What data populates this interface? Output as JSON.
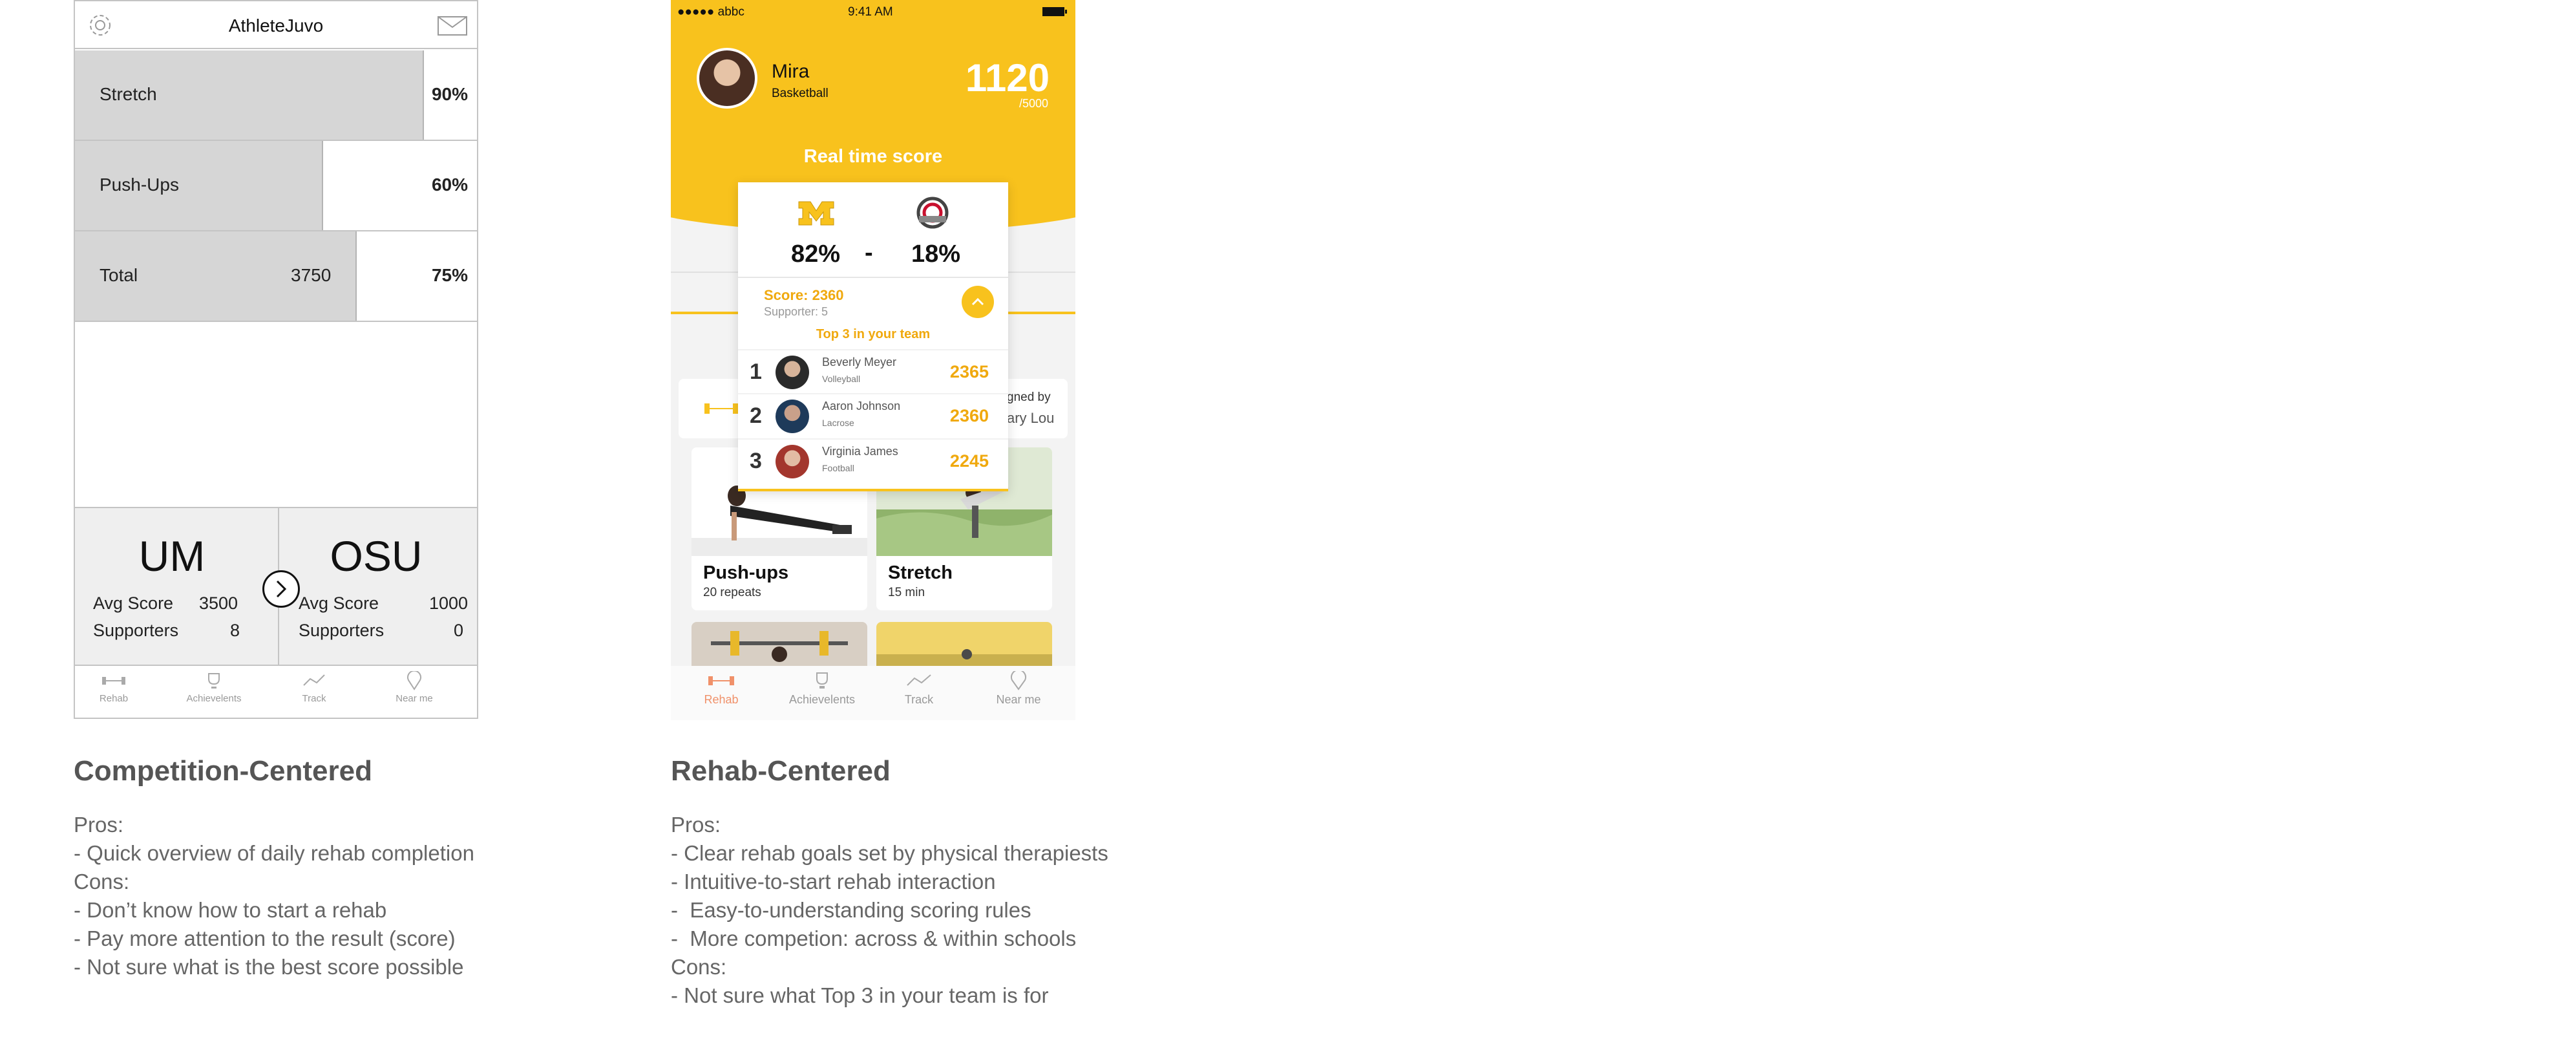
{
  "wireframe": {
    "app_title": "AthleteJuvo",
    "rows": [
      {
        "label": "Stretch",
        "percent": "90%",
        "fill": 0.9
      },
      {
        "label": "Push-Ups",
        "percent": "60%",
        "fill": 0.6
      },
      {
        "label": "Total",
        "value": "3750",
        "percent": "75%",
        "fill": 0.75
      }
    ],
    "teams": [
      {
        "name": "UM",
        "avg_label": "Avg Score",
        "avg": "3500",
        "sup_label": "Supporters",
        "sup": "8"
      },
      {
        "name": "OSU",
        "avg_label": "Avg Score",
        "avg": "1000",
        "sup_label": "Supporters",
        "sup": "0"
      }
    ],
    "tabs": [
      "Rehab",
      "Achievelents",
      "Track",
      "Near me"
    ]
  },
  "mockup": {
    "status": {
      "carrier": "●●●●● abbc",
      "time": "9:41 AM"
    },
    "profile": {
      "name": "Mira",
      "sport": "Basketball",
      "score": "1120",
      "max": "/5000"
    },
    "real_time_label": "Real time score",
    "popup": {
      "um_percent": "82%",
      "dash": "-",
      "osu_percent": "18%",
      "score_line": "Score: 2360",
      "supporter_line": "Supporter: 5",
      "top3_label": "Top 3 in your team",
      "ranking": [
        {
          "rank": "1",
          "name": "Beverly Meyer",
          "sport": "Volleyball",
          "score": "2365"
        },
        {
          "rank": "2",
          "name": "Aaron Johnson",
          "sport": "Lacrose",
          "score": "2360"
        },
        {
          "rank": "3",
          "name": "Virginia James",
          "sport": "Football",
          "score": "2245"
        }
      ]
    },
    "signed_line1": "gned by",
    "signed_line2": "ary Lou",
    "cards": [
      {
        "title": "Push-ups",
        "sub": "20 repeats"
      },
      {
        "title": "Stretch",
        "sub": "15 min"
      }
    ],
    "tabs": [
      "Rehab",
      "Achievelents",
      "Track",
      "Near me"
    ],
    "accent": "#f8c21d",
    "active_tab_color": "#f0916a"
  },
  "left_notes": {
    "heading": "Competition-Centered",
    "lines": [
      "Pros:",
      "- Quick overview of daily rehab completion",
      "Cons:",
      "- Don’t know how to start a rehab",
      "- Pay more attention to the result (score)",
      "- Not sure what is the best score possible"
    ]
  },
  "right_notes": {
    "heading": "Rehab-Centered",
    "lines": [
      "Pros:",
      "- Clear rehab goals set by physical therapiests",
      "- Intuitive-to-start rehab interaction",
      "-  Easy-to-understanding scoring rules",
      "-  More competion: across & within schools",
      "Cons:",
      "- Not sure what Top 3 in your team is for"
    ]
  }
}
